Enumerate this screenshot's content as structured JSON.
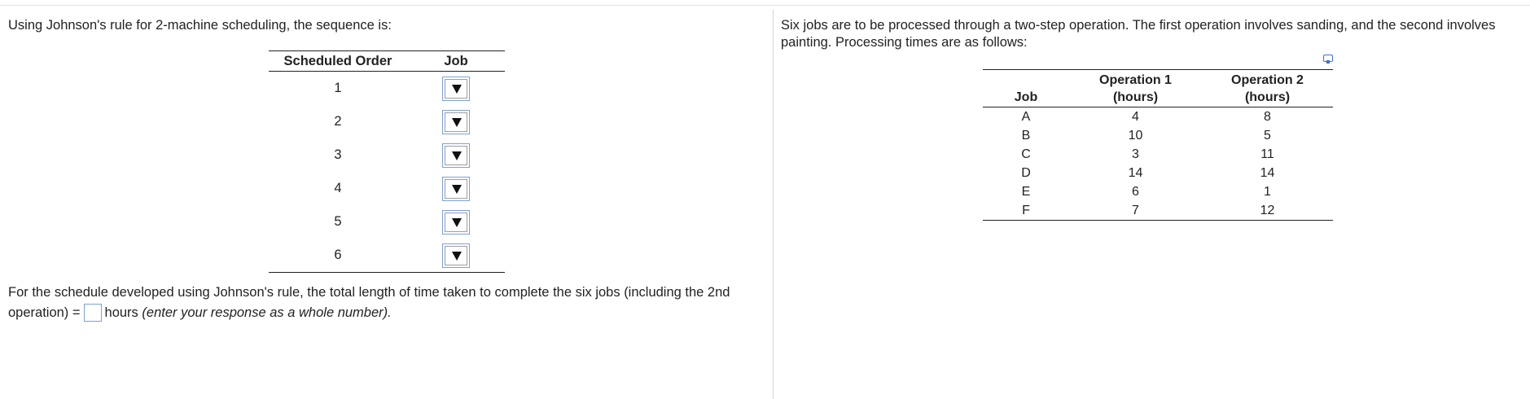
{
  "left": {
    "intro": "Using Johnson's rule for 2-machine scheduling, the sequence is:",
    "schedule_table": {
      "headers": {
        "order": "Scheduled Order",
        "job": "Job"
      },
      "rows": [
        {
          "order": "1",
          "job": ""
        },
        {
          "order": "2",
          "job": ""
        },
        {
          "order": "3",
          "job": ""
        },
        {
          "order": "4",
          "job": ""
        },
        {
          "order": "5",
          "job": ""
        },
        {
          "order": "6",
          "job": ""
        }
      ]
    },
    "result": {
      "prefix": "For the schedule developed using Johnson's rule, the total length of time taken to complete the six jobs (including the 2nd operation) =",
      "answer": "",
      "unit": "hours",
      "hint": "(enter your response as a whole number)."
    }
  },
  "right": {
    "intro": "Six jobs are to be processed through a two-step operation.  The first operation involves sanding, and the second involves painting. Processing times are as follows:",
    "ops_table": {
      "headers": {
        "job": "Job",
        "op1_line1": "Operation 1",
        "op1_line2": "(hours)",
        "op2_line1": "Operation 2",
        "op2_line2": "(hours)"
      },
      "rows": [
        {
          "job": "A",
          "op1": "4",
          "op2": "8"
        },
        {
          "job": "B",
          "op1": "10",
          "op2": "5"
        },
        {
          "job": "C",
          "op1": "3",
          "op2": "11"
        },
        {
          "job": "D",
          "op1": "14",
          "op2": "14"
        },
        {
          "job": "E",
          "op1": "6",
          "op2": "1"
        },
        {
          "job": "F",
          "op1": "7",
          "op2": "12"
        }
      ]
    }
  },
  "colors": {
    "input_border": "#7ea0d6",
    "icon_accent": "#3b6fd6",
    "divider": "#d4d4d4"
  }
}
